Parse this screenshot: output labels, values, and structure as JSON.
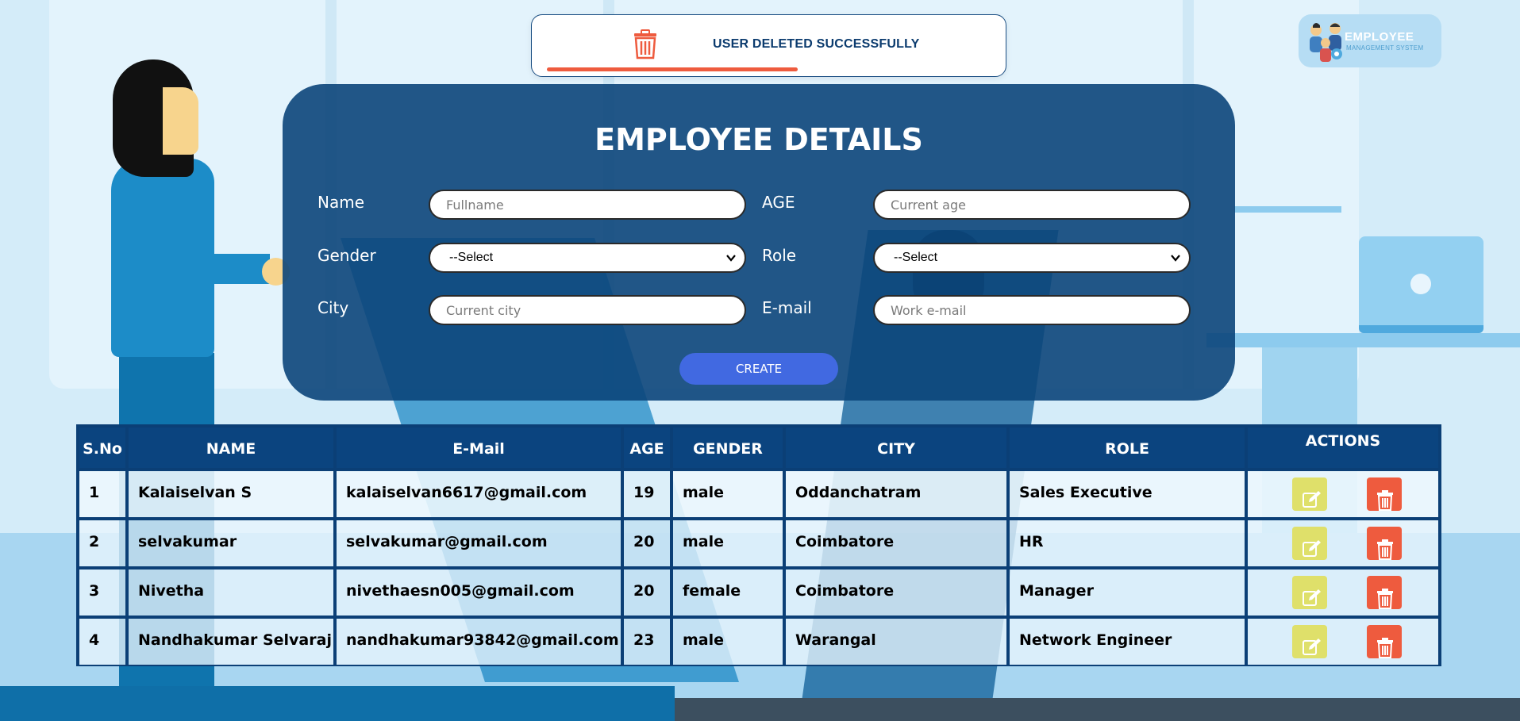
{
  "notification": {
    "message": "USER DELETED SUCCESSFULLY",
    "icon": "trash-icon",
    "progress": 0.53,
    "accent_color": "#ee5b3e"
  },
  "logo": {
    "line1": "EMPLOYEE",
    "line2": "MANAGEMENT SYSTEM"
  },
  "form": {
    "title": "EMPLOYEE DETAILS",
    "name_label": "Name",
    "name_placeholder": "Fullname",
    "age_label": "AGE",
    "age_placeholder": "Current age",
    "gender_label": "Gender",
    "gender_value": "--Select",
    "role_label": "Role",
    "role_value": "--Select",
    "city_label": "City",
    "city_placeholder": "Current city",
    "email_label": "E-mail",
    "email_placeholder": "Work e-mail",
    "create_label": "CREATE"
  },
  "table": {
    "headers": [
      "S.No",
      "NAME",
      "E-Mail",
      "AGE",
      "GENDER",
      "CITY",
      "ROLE",
      "ACTIONS"
    ],
    "rows": [
      [
        "1",
        "Kalaiselvan S",
        "kalaiselvan6617@gmail.com",
        "19",
        "male",
        "Oddanchatram",
        "Sales Executive"
      ],
      [
        "2",
        "selvakumar",
        "selvakumar@gmail.com",
        "20",
        "male",
        "Coimbatore",
        "HR"
      ],
      [
        "3",
        "Nivetha",
        "nivethaesn005@gmail.com",
        "20",
        "female",
        "Coimbatore",
        "Manager"
      ],
      [
        "4",
        "Nandhakumar Selvaraj",
        "nandhakumar93842@gmail.com",
        "23",
        "male",
        "Warangal",
        "Network Engineer"
      ]
    ],
    "edit_icon": "edit-icon",
    "delete_icon": "trash-icon",
    "header_color": "#0b447f",
    "edit_color": "#dfe06a",
    "delete_color": "#ee5b3e"
  }
}
